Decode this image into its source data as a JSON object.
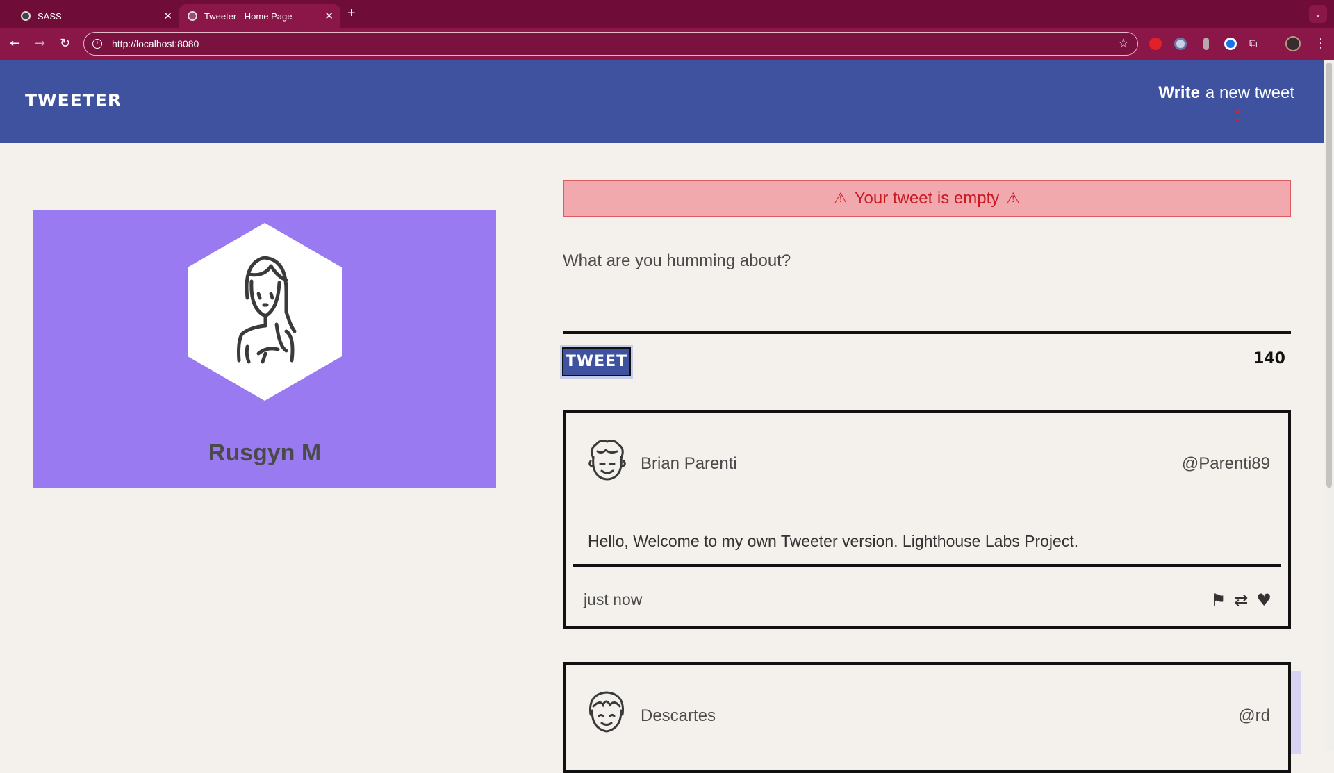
{
  "browser": {
    "tabs": [
      {
        "title": "SASS",
        "active": false
      },
      {
        "title": "Tweeter - Home Page",
        "active": true
      }
    ],
    "url": "http://localhost:8080",
    "colors": {
      "tabbar": "#6f0c38",
      "toolbar": "#8a1747"
    }
  },
  "header": {
    "brand": "TWEETER",
    "write_bold": "Write",
    "write_rest": "a new tweet",
    "colors": {
      "background": "#3e52a0",
      "arrow": "#d8232a"
    }
  },
  "profile": {
    "name": "Rusgyn M",
    "colors": {
      "card": "#9a7af0"
    }
  },
  "composer": {
    "error": "Your tweet is empty",
    "prompt": "What are you humming about?",
    "button": "TWEET",
    "counter": "140",
    "colors": {
      "error_bg": "#f1a9ae",
      "error_text": "#c91a24"
    }
  },
  "tweets": [
    {
      "name": "Brian Parenti",
      "handle": "@Parenti89",
      "content": "Hello, Welcome to my own Tweeter version. Lighthouse Labs Project.",
      "time": "just now",
      "actions": [
        "flag-icon",
        "retweet-icon",
        "heart-icon"
      ]
    },
    {
      "name": "Descartes",
      "handle": "@rd"
    }
  ]
}
